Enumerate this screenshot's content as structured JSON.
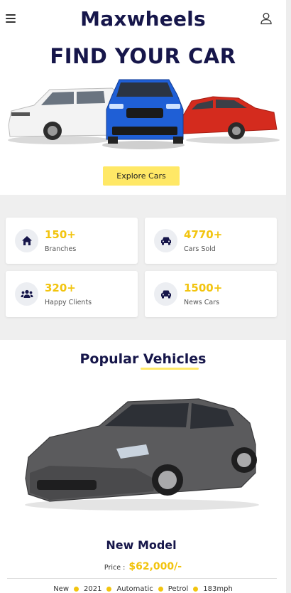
{
  "header": {
    "brand": "Maxwheels",
    "menu_icon": "hamburger-menu-icon",
    "user_icon": "user-icon"
  },
  "hero": {
    "title": "FIND YOUR CAR",
    "cta_label": "Explore Cars"
  },
  "stats": [
    {
      "value": "150+",
      "label": "Branches",
      "icon": "home-icon"
    },
    {
      "value": "4770+",
      "label": "Cars Sold",
      "icon": "car-icon"
    },
    {
      "value": "320+",
      "label": "Happy Clients",
      "icon": "users-icon"
    },
    {
      "value": "1500+",
      "label": "News Cars",
      "icon": "car-icon"
    }
  ],
  "popular": {
    "title": "Popular Vehicles",
    "vehicle": {
      "name": "New Model",
      "price_label": "Price :",
      "price": "$62,000/-",
      "specs": [
        "New",
        "2021",
        "Automatic",
        "Petrol",
        "183mph"
      ]
    }
  },
  "colors": {
    "accent": "#f2c40f",
    "button": "#ffe866",
    "navy": "#16164a",
    "stats_bg": "#efefef"
  }
}
